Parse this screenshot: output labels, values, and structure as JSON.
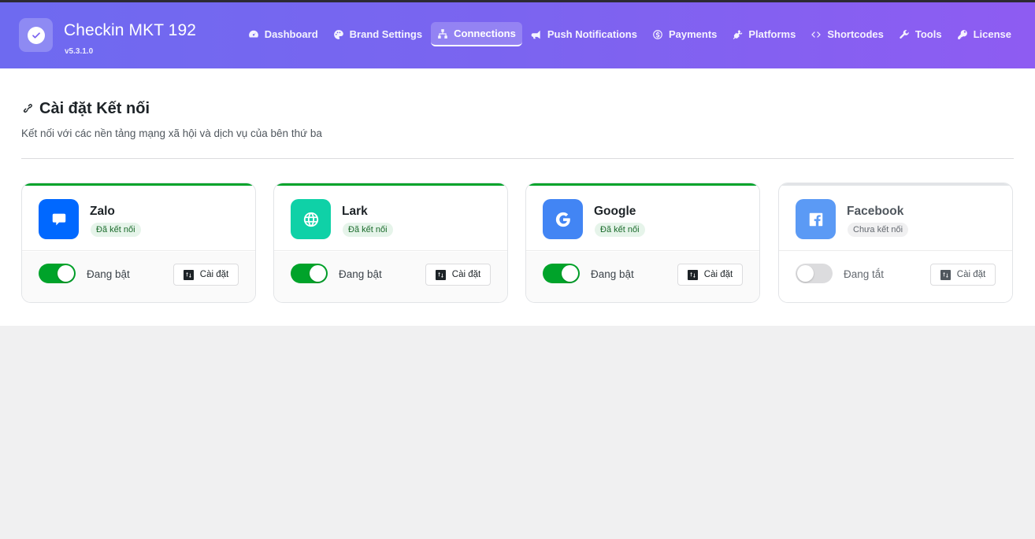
{
  "app": {
    "title": "Checkin MKT 192",
    "version": "v5.3.1.0"
  },
  "nav": [
    {
      "label": "Dashboard",
      "icon": "gauge-icon",
      "active": false
    },
    {
      "label": "Brand Settings",
      "icon": "palette-icon",
      "active": false
    },
    {
      "label": "Connections",
      "icon": "sitemap-icon",
      "active": true
    },
    {
      "label": "Push Notifications",
      "icon": "megaphone-icon",
      "active": false
    },
    {
      "label": "Payments",
      "icon": "dollar-circle-icon",
      "active": false
    },
    {
      "label": "Platforms",
      "icon": "plug-icon",
      "active": false
    },
    {
      "label": "Shortcodes",
      "icon": "code-icon",
      "active": false
    },
    {
      "label": "Tools",
      "icon": "wrench-icon",
      "active": false
    },
    {
      "label": "License",
      "icon": "key-icon",
      "active": false
    }
  ],
  "page": {
    "title": "Cài đặt Kết nối",
    "subtitle": "Kết nối với các nền tảng mạng xã hội và dịch vụ của bên thứ ba"
  },
  "connections": [
    {
      "name": "Zalo",
      "status": "Đã kết nối",
      "enabled": true,
      "toggle_label": "Đang bật",
      "settings_label": "Cài đặt",
      "color": "#0068ff",
      "icon": "chat-icon"
    },
    {
      "name": "Lark",
      "status": "Đã kết nối",
      "enabled": true,
      "toggle_label": "Đang bật",
      "settings_label": "Cài đặt",
      "color": "#0fd1a7",
      "icon": "globe-icon"
    },
    {
      "name": "Google",
      "status": "Đã kết nối",
      "enabled": true,
      "toggle_label": "Đang bật",
      "settings_label": "Cài đặt",
      "color": "#4285f4",
      "icon": "google-icon"
    },
    {
      "name": "Facebook",
      "status": "Chưa kết nối",
      "enabled": false,
      "toggle_label": "Đang tắt",
      "settings_label": "Cài đặt",
      "color": "#5b9af5",
      "icon": "facebook-icon"
    }
  ],
  "colors": {
    "header_start": "#6e6af0",
    "header_end": "#8e5cf2",
    "accent_on": "#00a32a"
  }
}
